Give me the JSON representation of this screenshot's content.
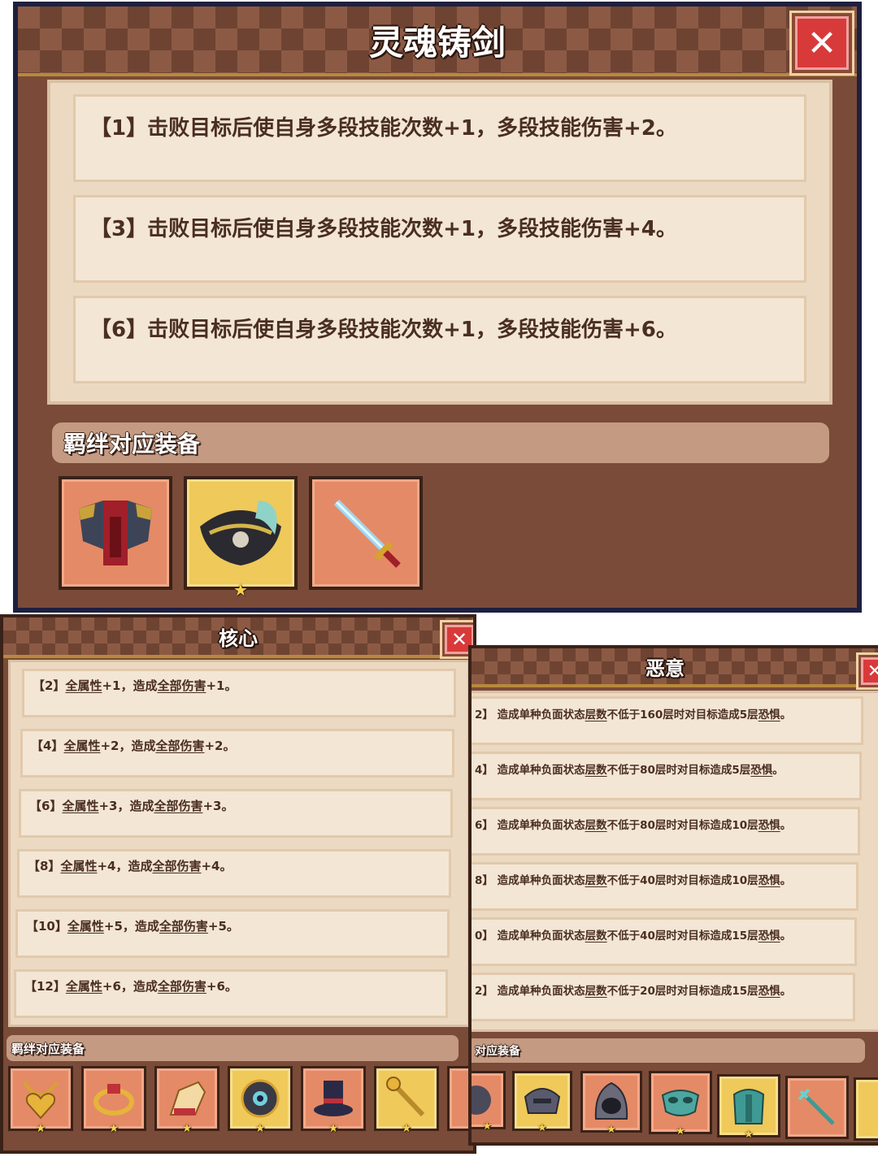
{
  "main_panel": {
    "title": "灵魂铸剑",
    "close": "✕",
    "bonuses": [
      "【1】击败目标后使自身多段技能次数+1，多段技能伤害+2。",
      "【3】击败目标后使自身多段技能次数+1，多段技能伤害+4。",
      "【6】击败目标后使自身多段技能次数+1，多段技能伤害+6。"
    ],
    "equip_header": "羁绊对应装备",
    "equipment": [
      {
        "icon": "armor-icon",
        "rarity": "orange",
        "star": false
      },
      {
        "icon": "pirate-hat-icon",
        "rarity": "gold",
        "star": true
      },
      {
        "icon": "sword-icon",
        "rarity": "orange",
        "star": false
      }
    ]
  },
  "core_panel": {
    "title": "核心",
    "close": "✕",
    "bonuses": [
      {
        "tier": "【2】",
        "a": "全属性",
        "b": "+1，造成",
        "c": "全部伤害",
        "d": "+1。"
      },
      {
        "tier": "【4】",
        "a": "全属性",
        "b": "+2，造成",
        "c": "全部伤害",
        "d": "+2。"
      },
      {
        "tier": "【6】",
        "a": "全属性",
        "b": "+3，造成",
        "c": "全部伤害",
        "d": "+3。"
      },
      {
        "tier": "【8】",
        "a": "全属性",
        "b": "+4，造成",
        "c": "全部伤害",
        "d": "+4。"
      },
      {
        "tier": "【10】",
        "a": "全属性",
        "b": "+5，造成",
        "c": "全部伤害",
        "d": "+5。"
      },
      {
        "tier": "【12】",
        "a": "全属性",
        "b": "+6，造成",
        "c": "全部伤害",
        "d": "+6。"
      }
    ],
    "equip_header": "羁绊对应装备",
    "equipment": [
      {
        "icon": "heart-necklace-icon",
        "rarity": "orange"
      },
      {
        "icon": "ring-icon",
        "rarity": "orange"
      },
      {
        "icon": "gauntlet-icon",
        "rarity": "orange"
      },
      {
        "icon": "eye-amulet-icon",
        "rarity": "gold"
      },
      {
        "icon": "top-hat-icon",
        "rarity": "orange"
      },
      {
        "icon": "staff-icon",
        "rarity": "gold"
      }
    ]
  },
  "malice_panel": {
    "title": "恶意",
    "bonuses": [
      {
        "tier": "2】",
        "pre": "造成单种负面状态",
        "u1": "层数",
        "mid": "不低于160层时对目标造成5层",
        "u2": "恐惧",
        "end": "。"
      },
      {
        "tier": "4】",
        "pre": "造成单种负面状态",
        "u1": "层数",
        "mid": "不低于80层时对目标造成5层",
        "u2": "恐惧",
        "end": "。"
      },
      {
        "tier": "6】",
        "pre": "造成单种负面状态",
        "u1": "层数",
        "mid": "不低于80层时对目标造成10层",
        "u2": "恐惧",
        "end": "。"
      },
      {
        "tier": "8】",
        "pre": "造成单种负面状态",
        "u1": "层数",
        "mid": "不低于40层时对目标造成10层",
        "u2": "恐惧",
        "end": "。"
      },
      {
        "tier": "0】",
        "pre": "造成单种负面状态",
        "u1": "层数",
        "mid": "不低于40层时对目标造成15层",
        "u2": "恐惧",
        "end": "。"
      },
      {
        "tier": "2】",
        "pre": "造成单种负面状态",
        "u1": "层数",
        "mid": "不低于20层时对目标造成15层",
        "u2": "恐惧",
        "end": "。"
      }
    ],
    "equip_header": "对应装备",
    "equipment": [
      {
        "icon": "dark-orb-icon",
        "rarity": "orange"
      },
      {
        "icon": "iron-helm-icon",
        "rarity": "gold"
      },
      {
        "icon": "hood-icon",
        "rarity": "orange"
      },
      {
        "icon": "mask-icon",
        "rarity": "orange"
      },
      {
        "icon": "ghost-armor-icon",
        "rarity": "gold"
      },
      {
        "icon": "trident-icon",
        "rarity": "orange"
      }
    ]
  }
}
